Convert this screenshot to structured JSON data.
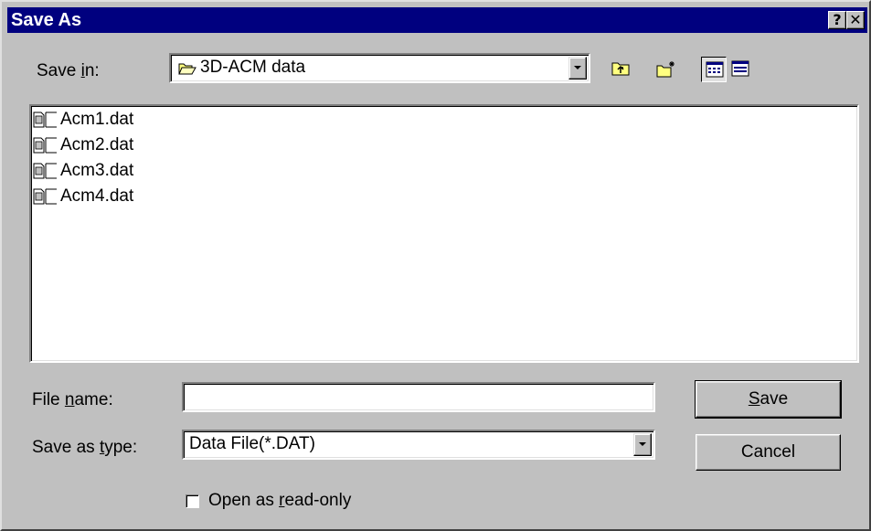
{
  "window": {
    "title": "Save As",
    "help_label": "?",
    "close_label": "✕"
  },
  "save_in": {
    "label_pre": "Save ",
    "label_key": "i",
    "label_post": "n:",
    "value": "3D-ACM data",
    "icon": "folder-open-icon"
  },
  "toolbar": {
    "buttons": [
      {
        "name": "up-one-level",
        "icon": "folder-up-icon"
      },
      {
        "name": "create-new-folder",
        "icon": "new-folder-icon"
      },
      {
        "name": "list-view",
        "icon": "list-view-icon",
        "pressed": true
      },
      {
        "name": "details-view",
        "icon": "details-view-icon",
        "pressed": false
      }
    ]
  },
  "files": [
    {
      "name": "Acm1.dat",
      "icon": "file-icon"
    },
    {
      "name": "Acm2.dat",
      "icon": "file-icon"
    },
    {
      "name": "Acm3.dat",
      "icon": "file-icon"
    },
    {
      "name": "Acm4.dat",
      "icon": "file-icon"
    }
  ],
  "file_name": {
    "label_pre": "File ",
    "label_key": "n",
    "label_post": "ame:",
    "value": ""
  },
  "save_as_type": {
    "label_pre": "Save as ",
    "label_key": "t",
    "label_post": "ype:",
    "value": "Data File(*.DAT)"
  },
  "buttons": {
    "save_key": "S",
    "save_post": "ave",
    "cancel_label": "Cancel"
  },
  "read_only": {
    "label_pre": "Open as ",
    "label_key": "r",
    "label_post": "ead-only",
    "checked": false
  },
  "colors": {
    "titlebar": "#00007f",
    "face": "#c0c0c0"
  }
}
